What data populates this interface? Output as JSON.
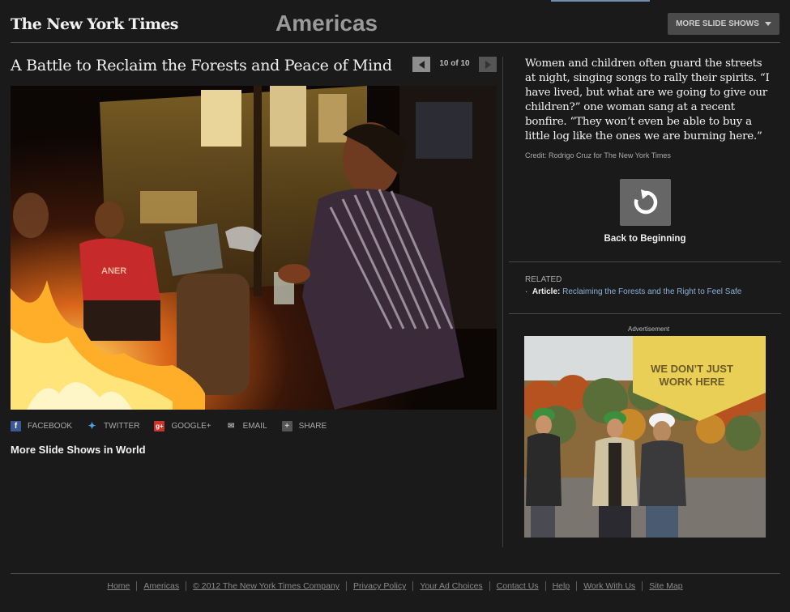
{
  "header": {
    "logo": "The New York Times",
    "section": "Americas",
    "more_slideshows": "MORE SLIDE SHOWS"
  },
  "slideshow": {
    "headline": "A Battle to Reclaim the Forests and Peace of Mind",
    "counter": "10 of 10",
    "caption": "Women and children often guard the streets at night, singing songs to rally their spirits. “I have lived, but what are we going to give our children?” one woman sang at a recent bonfire. “They won’t even be able to buy a little log like the ones we are burning here.”",
    "credit": "Credit: Rodrigo Cruz for The New York Times",
    "back_label": "Back to Beginning"
  },
  "share": {
    "facebook": "FACEBOOK",
    "twitter": "TWITTER",
    "googleplus": "GOOGLE+",
    "email": "EMAIL",
    "share": "SHARE"
  },
  "more_in_world": "More Slide Shows in World",
  "related": {
    "heading": "RELATED",
    "prefix": "Article:",
    "link": "Reclaiming the Forests and the Right to Feel Safe"
  },
  "ad": {
    "label": "Advertisement",
    "line1": "WE DON’T JUST",
    "line2": "WORK HERE"
  },
  "photo_text": {
    "shirt": "ANER"
  },
  "footer": [
    "Home",
    "Americas",
    "© 2012 The New York Times Company",
    "Privacy Policy",
    "Your Ad Choices",
    "Contact Us",
    "Help",
    "Work With Us",
    "Site Map"
  ],
  "colors": {
    "background": "#1a1a1a",
    "link": "#8ab2d8",
    "ad_banner": "#e9cf55"
  }
}
